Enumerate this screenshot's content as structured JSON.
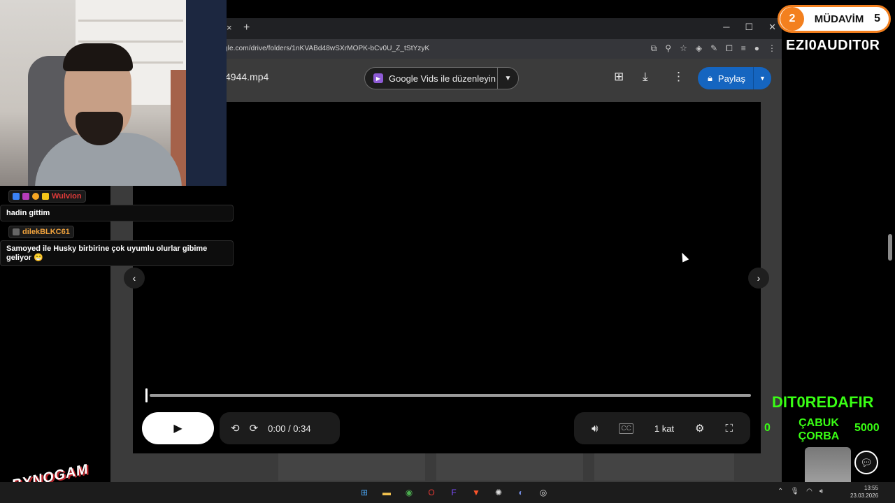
{
  "browser": {
    "url": "gle.com/drive/folders/1nKVABd48wSXrMOPK-bCv0U_Z_tStYzyK",
    "tab_close_glyph": "×",
    "new_tab_glyph": "+"
  },
  "viewer": {
    "file_title": "4944.mp4",
    "vids_button_label": "Google Vids ile düzenleyin",
    "share_button_label": "Paylaş"
  },
  "player": {
    "current_time": "0:00 / 0:34",
    "speed_label": "1 kat",
    "progress_fraction": 0.0
  },
  "chat": {
    "messages": [
      {
        "user": "Wulvion",
        "user_color": "#e03a3a",
        "text": "hadin gittim"
      },
      {
        "user": "dilekBLKC61",
        "user_color": "#f0a23c",
        "text": "Samoyed ile Husky birbirine çok uyumlu olurlar gibime geliyor 😁"
      }
    ]
  },
  "overlays": {
    "mudavim_rank": "2",
    "mudavim_label": "MÜDAVİM",
    "mudavim_count": "5",
    "auditor_name": "EZI0AUDIT0R",
    "redafir_name": "DIT0REDAFIR",
    "corba_left": "0",
    "corba_label": "ÇABUK ÇORBA",
    "corba_right": "5000",
    "logo_text": "BYNOGAM"
  },
  "taskbar": {
    "time": "13:55",
    "date": "23.03.2026"
  },
  "colors": {
    "accent_share": "#1565c0",
    "mudavim_orange": "#f3801f",
    "neon_green": "#39ff14"
  }
}
